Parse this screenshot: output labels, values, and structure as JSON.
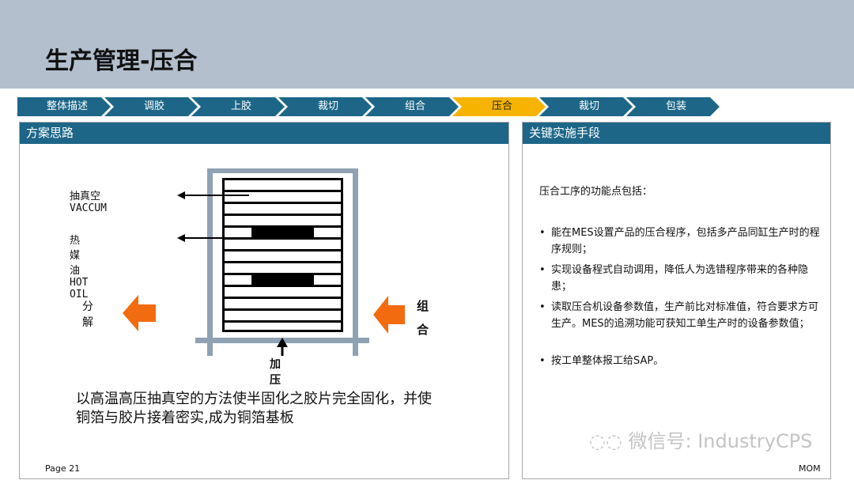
{
  "title": "生产管理-压合",
  "steps": [
    "整体描述",
    "调胶",
    "上胶",
    "裁切",
    "组合",
    "压合",
    "裁切",
    "包装"
  ],
  "active_step": 5,
  "left_panel": {
    "title": "方案思路",
    "diagram": {
      "vacuum": "抽真空 VACCUM",
      "hot_oil": "热媒油 HOT OIL",
      "decompose": "分解",
      "combine": "组合",
      "pressure": "加压"
    },
    "caption_line1": "以高温高压抽真空的方法使半固化之胶片完全固化，并使",
    "caption_line2": "铜箔与胶片接着密实,成为铜箔基板"
  },
  "right_panel": {
    "title": "关键实施手段",
    "intro": "压合工序的功能点包括：",
    "bullets": [
      "能在MES设置产品的压合程序，包括多产品同缸生产时的程序规则；",
      "实现设备程式自动调用，降低人为选错程序带来的各种隐患；",
      "读取压合机设备参数值，生产前比对标准值，符合要求方可生产。MES的追溯功能可获知工单生产时的设备参数值；",
      "按工单整体报工给SAP。"
    ]
  },
  "footer": {
    "page": "Page 21",
    "mom": "MOM",
    "watermark": "微信号: IndustryCPS"
  },
  "colors": {
    "header": "#b3bfcd",
    "teal": "#1d6688",
    "active": "#f6b400",
    "orange": "#f26b0f"
  }
}
